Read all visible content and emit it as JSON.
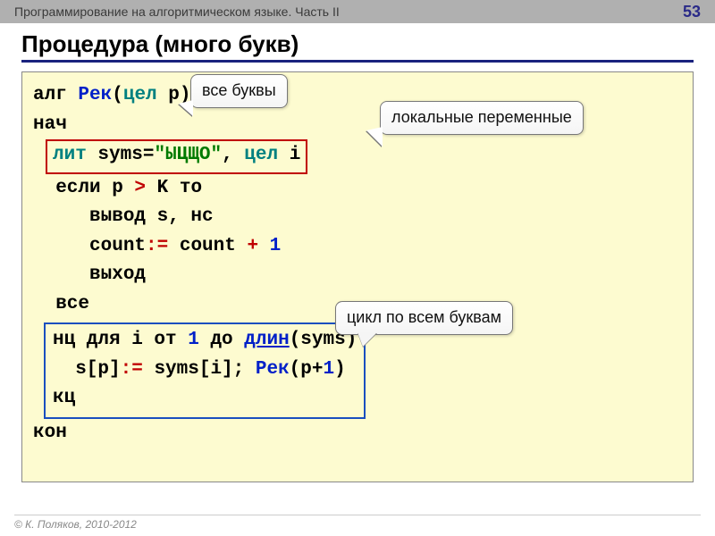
{
  "header": {
    "title": "Программирование на алгоритмическом языке. Часть II",
    "page": "53"
  },
  "slide_title": "Процедура (много букв)",
  "callouts": {
    "c1": "все буквы",
    "c2": "локальные переменные",
    "c3": "цикл по всем буквам"
  },
  "code": {
    "l1_alg": "алг ",
    "l1_name": "Рек",
    "l1_paren_open": "(",
    "l1_tsel": "цел",
    "l1_p": " p)",
    "l2": "нач",
    "l3_lit": "лит ",
    "l3_syms": "syms=",
    "l3_str": "\"ЫЦЩО\"",
    "l3_comma": ", ",
    "l3_tsel": "цел",
    "l3_i": " i",
    "l4_a": "  если p",
    "l4_gt": " > ",
    "l4_b": "K то",
    "l5": "     вывод s, нс",
    "l6_a": "     count",
    "l6_assign": ":= ",
    "l6_b": "count",
    "l6_plus": " + ",
    "l6_one": "1",
    "l7": "     выход",
    "l8": "  все",
    "l9_nc": "нц для i от ",
    "l9_one": "1",
    "l9_do": " до ",
    "l9_dlin": "длин",
    "l9_tail": "(syms)",
    "l10_a": "  s[p]",
    "l10_assign": ":= ",
    "l10_b": "syms[i]; ",
    "l10_rek": "Рек",
    "l10_c": "(p+",
    "l10_one": "1",
    "l10_close": ")",
    "l11": "кц",
    "l12": "кон"
  },
  "footer": "© К. Поляков, 2010-2012"
}
